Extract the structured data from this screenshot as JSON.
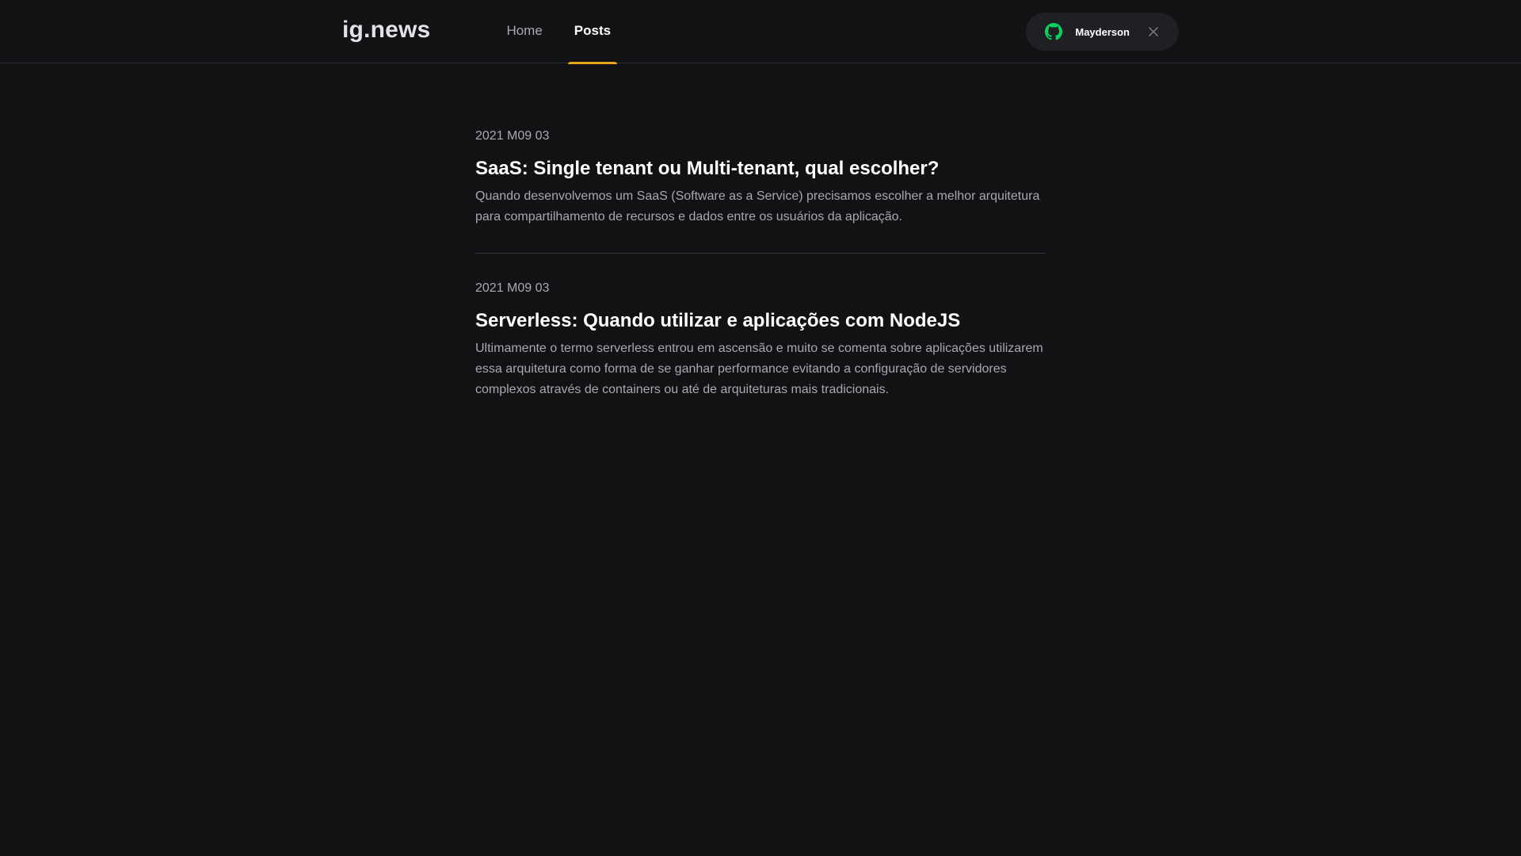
{
  "header": {
    "logo": "ig.news",
    "nav": [
      {
        "label": "Home",
        "active": false
      },
      {
        "label": "Posts",
        "active": true
      }
    ],
    "user": {
      "name": "Mayderson",
      "icon": "github-icon",
      "close_icon": "close-icon"
    }
  },
  "posts": [
    {
      "date": "2021 M09 03",
      "title": "SaaS: Single tenant ou Multi-tenant, qual escolher?",
      "excerpt": "Quando desenvolvemos um SaaS (Software as a Service) precisamos escolher a melhor arquitetura para compartilhamento de recursos e dados entre os usuários da aplicação."
    },
    {
      "date": "2021 M09 03",
      "title": "Serverless: Quando utilizar e aplicações com NodeJS",
      "excerpt": "Ultimamente o termo serverless entrou em ascensão e muito se comenta sobre aplicações utilizarem essa arquitetura como forma de se ganhar performance evitando a configuração de servidores complexos através de containers ou até de arquiteturas mais tradicionais."
    }
  ],
  "colors": {
    "background": "#121214",
    "accent": "#eba417",
    "github_green": "#04d361"
  }
}
